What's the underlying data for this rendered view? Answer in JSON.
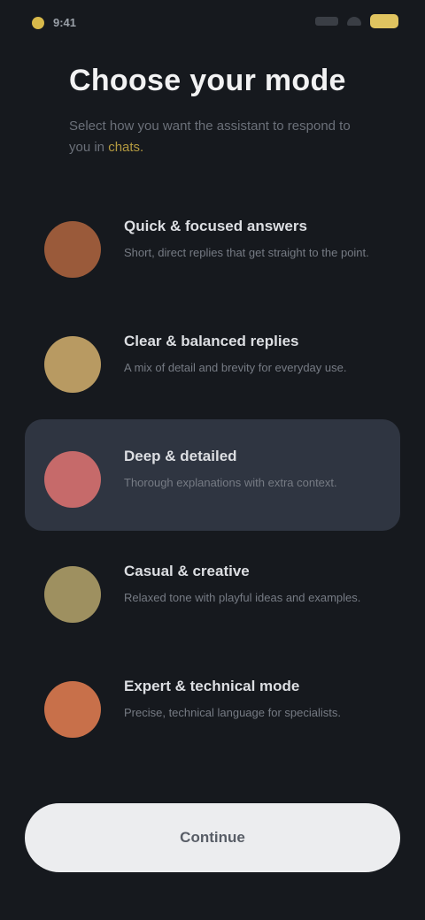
{
  "status_bar": {
    "time": "9:41"
  },
  "header": {
    "title": "Choose your mode",
    "subtitle_lead": "Select how you want the assistant to respond to you in",
    "subtitle_accent": "chats."
  },
  "modes": [
    {
      "id": "focused",
      "title": "Quick & focused answers",
      "description": "Short, direct replies that get straight to the point.",
      "avatar_color": "#9a5a3a",
      "selected": false
    },
    {
      "id": "balanced",
      "title": "Clear & balanced replies",
      "description": "A mix of detail and brevity for everyday use.",
      "avatar_color": "#b89a62",
      "selected": false
    },
    {
      "id": "detailed",
      "title": "Deep & detailed",
      "description": "Thorough explanations with extra context.",
      "avatar_color": "#c66a6a",
      "selected": true
    },
    {
      "id": "creative",
      "title": "Casual & creative",
      "description": "Relaxed tone with playful ideas and examples.",
      "avatar_color": "#9e9060",
      "selected": false
    },
    {
      "id": "expert",
      "title": "Expert & technical mode",
      "description": "Precise, technical language for specialists.",
      "avatar_color": "#c8704a",
      "selected": false
    }
  ],
  "footer": {
    "continue_label": "Continue"
  }
}
